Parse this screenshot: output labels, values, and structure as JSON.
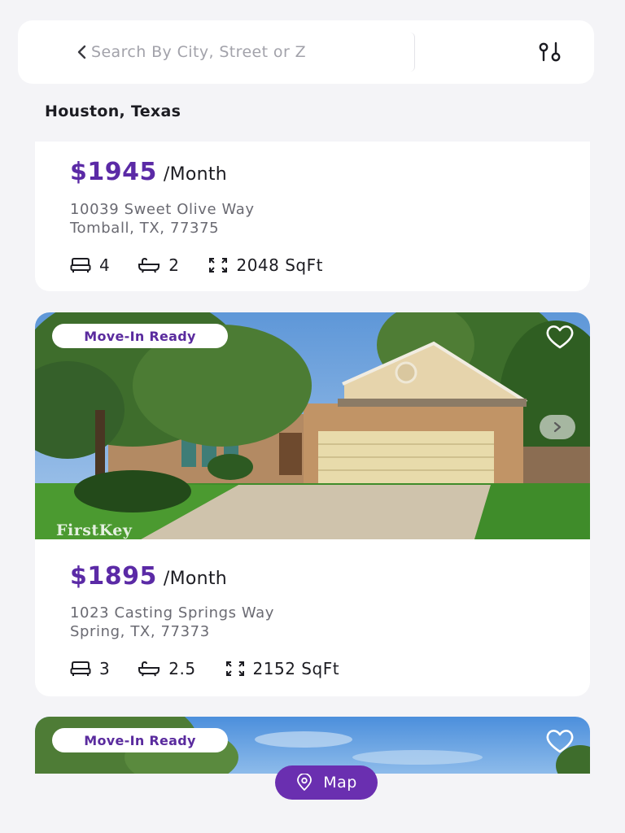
{
  "search": {
    "placeholder": "Search By City, Street or Z"
  },
  "location_title": "Houston, Texas",
  "listings": [
    {
      "price": "$1945",
      "period": "/Month",
      "address_line1": "10039 Sweet Olive Way",
      "address_line2": "Tomball, TX, 77375",
      "beds": "4",
      "baths": "2",
      "sqft": "2048 SqFt"
    },
    {
      "badge": "Move-In Ready",
      "watermark": "FirstKey",
      "price": "$1895",
      "period": "/Month",
      "address_line1": "1023 Casting Springs Way",
      "address_line2": "Spring, TX, 77373",
      "beds": "3",
      "baths": "2.5",
      "sqft": "2152 SqFt"
    },
    {
      "badge": "Move-In Ready"
    }
  ],
  "map_button": {
    "label": "Map"
  },
  "colors": {
    "accent": "#6a2fb0",
    "price": "#5b2aa6",
    "background": "#f4f4f7"
  },
  "icons": {
    "back": "chevron-left-icon",
    "filter": "filter-sliders-icon",
    "bed": "bed-icon",
    "bath": "bathtub-icon",
    "area": "expand-arrows-icon",
    "favorite": "heart-icon",
    "next": "chevron-right-icon",
    "map": "map-pin-icon"
  }
}
